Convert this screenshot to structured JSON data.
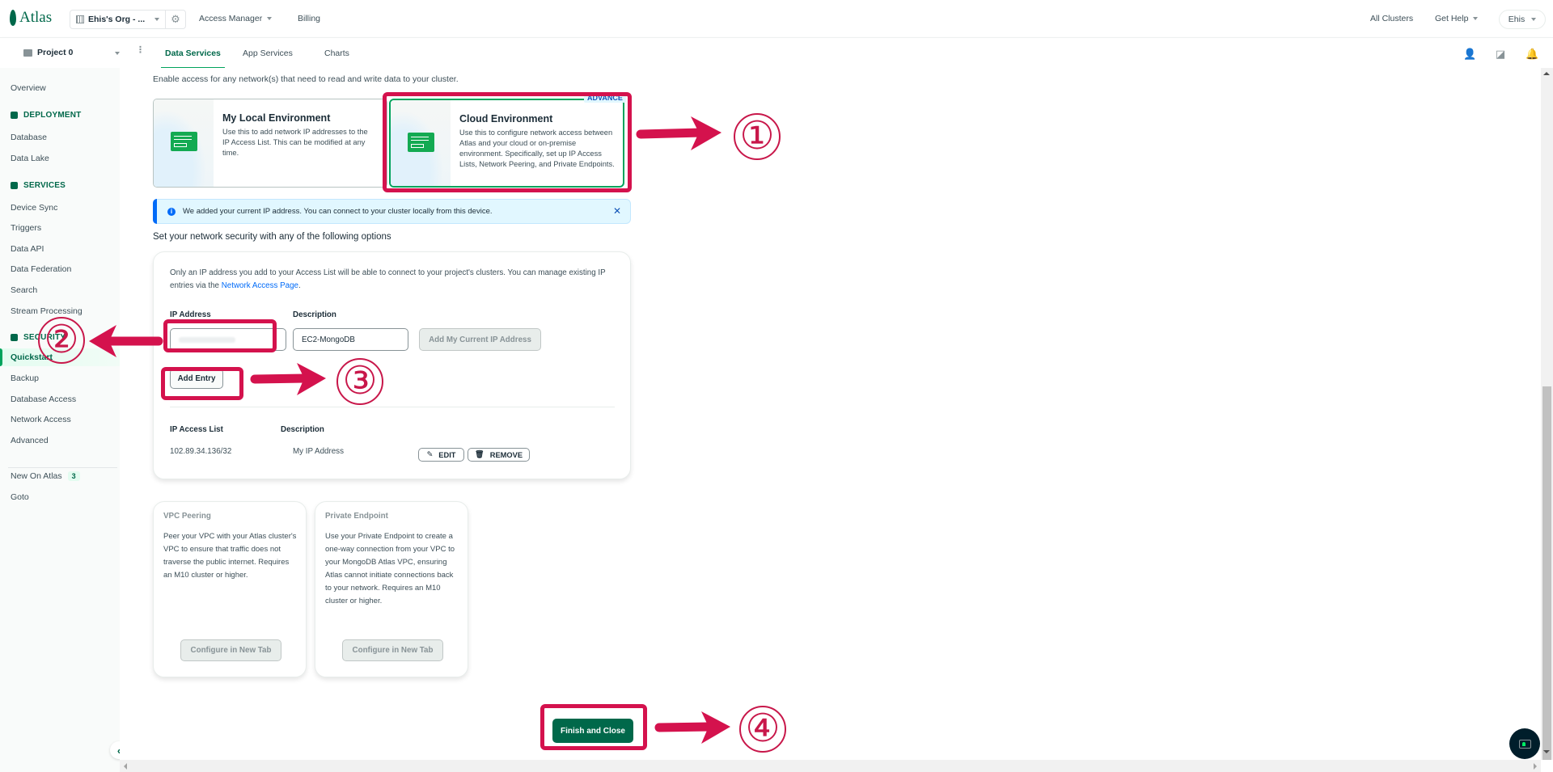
{
  "topbar": {
    "logo_text": "Atlas",
    "org_name": "Ehis's Org - ...",
    "nav": [
      {
        "label": "Access Manager",
        "has_dropdown": true
      },
      {
        "label": "Billing",
        "has_dropdown": false
      }
    ],
    "right": [
      {
        "label": "All Clusters",
        "has_dropdown": false
      },
      {
        "label": "Get Help",
        "has_dropdown": true
      }
    ],
    "user": "Ehis"
  },
  "subbar": {
    "project": "Project 0",
    "tabs": [
      {
        "label": "Data Services",
        "active": true
      },
      {
        "label": "App Services",
        "active": false
      },
      {
        "label": "Charts",
        "active": false
      }
    ],
    "icons": [
      "invite-user-icon",
      "activity-feed-icon",
      "notifications-bell-icon"
    ]
  },
  "sidebar": {
    "overview": "Overview",
    "sections": [
      {
        "heading": "DEPLOYMENT",
        "icon": "database-icon",
        "items": [
          "Database",
          "Data Lake"
        ]
      },
      {
        "heading": "SERVICES",
        "icon": "services-icon",
        "items": [
          "Device Sync",
          "Triggers",
          "Data API",
          "Data Federation",
          "Search",
          "Stream Processing"
        ]
      },
      {
        "heading": "SECURITY",
        "icon": "lock-icon",
        "items": [
          "Quickstart",
          "Backup",
          "Database Access",
          "Network Access",
          "Advanced"
        ]
      }
    ],
    "active_item": "Quickstart",
    "footer": [
      {
        "label": "New On Atlas",
        "badge": "3"
      },
      {
        "label": "Goto"
      }
    ]
  },
  "main": {
    "intro": "Enable access for any network(s) that need to read and write data to your cluster.",
    "env_cards": [
      {
        "title": "My Local Environment",
        "description": "Use this to add network IP addresses to the IP Access List. This can be modified at any time.",
        "selected": false
      },
      {
        "title": "Cloud Environment",
        "description": "Use this to configure network access between Atlas and your cloud or on-premise environment. Specifically, set up IP Access Lists, Network Peering, and Private Endpoints.",
        "selected": true,
        "badge": "ADVANCE"
      }
    ],
    "banner": {
      "text": "We added your current IP address. You can connect to your cluster locally from this device.",
      "close": "✕"
    },
    "options_title": "Set your network security with any of the following options",
    "access_card": {
      "desc_prefix": "Only an IP address you add to your Access List will be able to connect to your project's clusters. You can manage existing IP entries via the ",
      "desc_link": "Network Access Page",
      "desc_suffix": ".",
      "ip_label": "IP Address",
      "ip_value": "",
      "description_label": "Description",
      "description_value": "EC2-MongoDB",
      "add_current_ip": "Add My Current IP Address",
      "add_entry": "Add Entry",
      "list_headers": [
        "IP Access List",
        "Description"
      ],
      "rows": [
        {
          "ip": "102.89.34.136/32",
          "description": "My IP Address",
          "edit": "EDIT",
          "remove": "REMOVE"
        }
      ]
    },
    "mini_cards": [
      {
        "title": "VPC Peering",
        "description": "Peer your VPC with your Atlas cluster's VPC to ensure that traffic does not traverse the public internet. Requires an M10 cluster or higher.",
        "button": "Configure in New Tab"
      },
      {
        "title": "Private Endpoint",
        "description": "Use your Private Endpoint to create a one-way connection from your VPC to your MongoDB Atlas VPC, ensuring Atlas cannot initiate connections back to your network. Requires an M10 cluster or higher.",
        "button": "Configure in New Tab"
      }
    ],
    "finish_button": "Finish and Close"
  },
  "annotations": {
    "color": "#d4124d",
    "steps": [
      "①",
      "②",
      "③",
      "④"
    ]
  }
}
